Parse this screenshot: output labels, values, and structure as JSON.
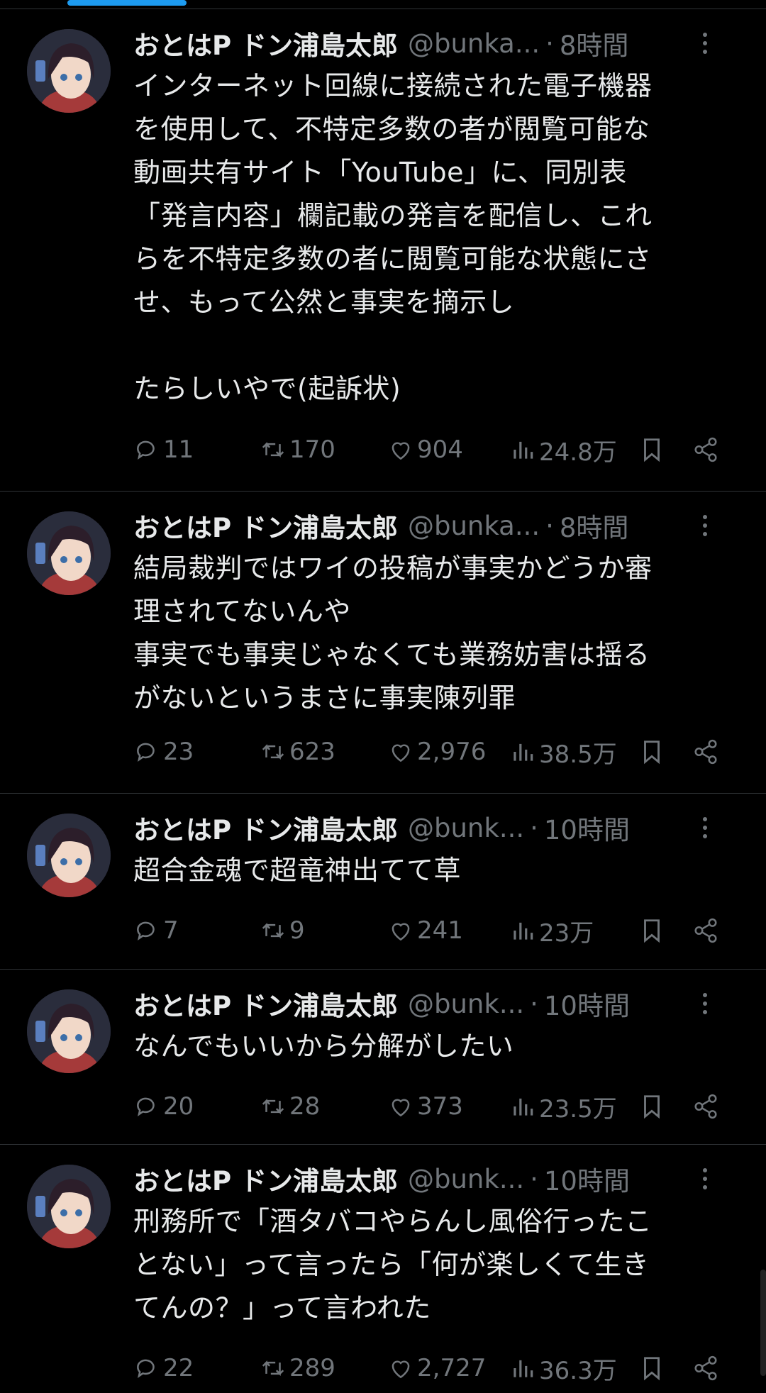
{
  "author": {
    "name": "おとはP ドン浦島太郎"
  },
  "tweets": [
    {
      "handle": "@bunka...",
      "time": "8時間",
      "text": "インターネット回線に接続された電子機器\nを使用して、不特定多数の者が閲覧可能な\n動画共有サイト「YouTube」に、同別表\n「発言内容」欄記載の発言を配信し、これ\nらを不特定多数の者に閲覧可能な状態にさ\nせ、もって公然と事実を摘示し\n\nたらしいやで(起訴状)",
      "replies": "11",
      "retweets": "170",
      "likes": "904",
      "views": "24.8万"
    },
    {
      "handle": "@bunka...",
      "time": "8時間",
      "text": "結局裁判ではワイの投稿が事実かどうか審\n理されてないんや\n事実でも事実じゃなくても業務妨害は揺る\nがないというまさに事実陳列罪",
      "replies": "23",
      "retweets": "623",
      "likes": "2,976",
      "views": "38.5万"
    },
    {
      "handle": "@bunk...",
      "time": "10時間",
      "text": "超合金魂で超竜神出てて草",
      "replies": "7",
      "retweets": "9",
      "likes": "241",
      "views": "23万"
    },
    {
      "handle": "@bunk...",
      "time": "10時間",
      "text": "なんでもいいから分解がしたい",
      "replies": "20",
      "retweets": "28",
      "likes": "373",
      "views": "23.5万"
    },
    {
      "handle": "@bunk...",
      "time": "10時間",
      "text": "刑務所で「酒タバコやらんし風俗行ったこ\nとない」って言ったら「何が楽しくて生き\nてんの？」って言われた",
      "replies": "22",
      "retweets": "289",
      "likes": "2,727",
      "views": "36.3万"
    }
  ],
  "colors": {
    "background": "#000000",
    "text": "#e7e9ea",
    "muted": "#71767b",
    "accent": "#1d9bf0",
    "divider": "#2f3336"
  },
  "icons": [
    "reply-icon",
    "retweet-icon",
    "like-icon",
    "views-icon",
    "bookmark-icon",
    "share-icon",
    "more-icon"
  ]
}
